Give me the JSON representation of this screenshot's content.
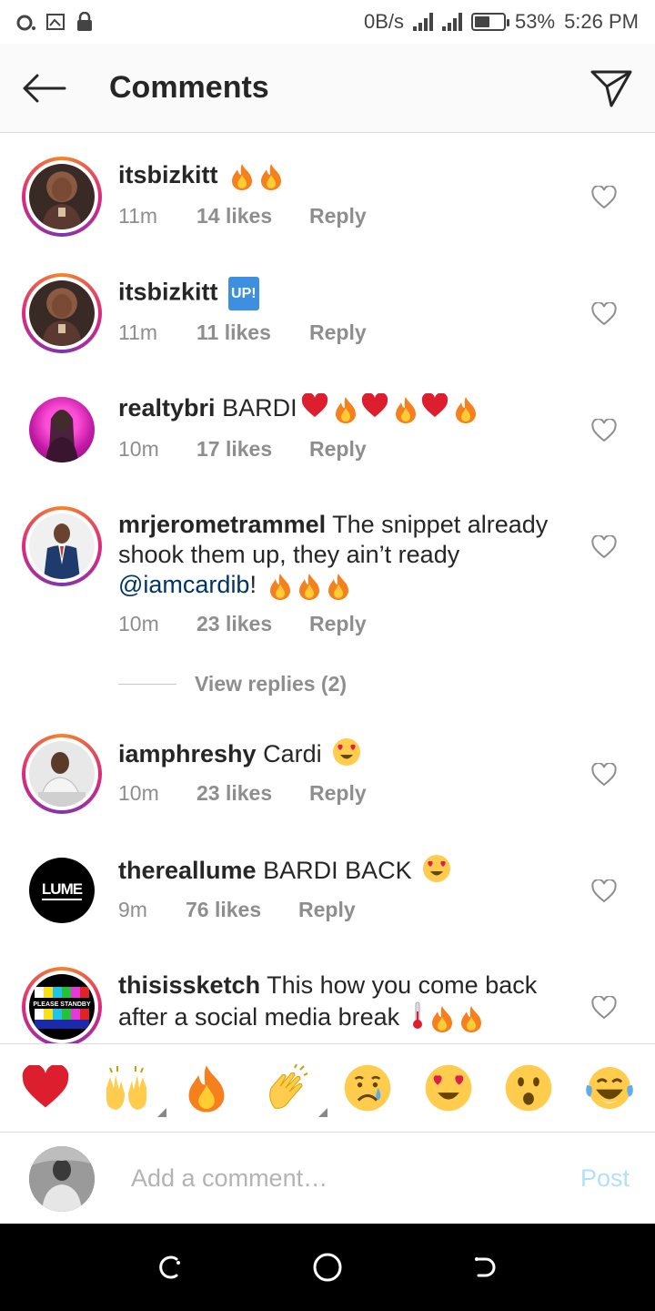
{
  "status_bar": {
    "speed": "0B/s",
    "battery": "53%",
    "battery_level": 0.53,
    "time": "5:26 PM"
  },
  "header": {
    "title": "Comments"
  },
  "comments": [
    {
      "username": "itsbizkitt",
      "text": "",
      "time": "11m",
      "likes": "14 likes",
      "reply": "Reply",
      "emoji": [
        "fire",
        "fire"
      ]
    },
    {
      "username": "itsbizkitt",
      "text": "",
      "badge": "UP!",
      "time": "11m",
      "likes": "11 likes",
      "reply": "Reply"
    },
    {
      "username": "realtybri",
      "text": "BARDI",
      "time": "10m",
      "likes": "17 likes",
      "reply": "Reply",
      "emoji": [
        "heart",
        "fire",
        "heart",
        "fire",
        "heart",
        "fire"
      ]
    },
    {
      "username": "mrjerometrammel",
      "text": "The snippet already shook them up, they ain’t ready",
      "mention": "@iamcardib",
      "after_mention": "!",
      "time": "10m",
      "likes": "23 likes",
      "reply": "Reply",
      "emoji": [
        "fire",
        "fire",
        "fire"
      ]
    },
    {
      "username": "iamphreshy",
      "text": "Cardi",
      "time": "10m",
      "likes": "23 likes",
      "reply": "Reply",
      "emoji": [
        "heart-eyes"
      ]
    },
    {
      "username": "thereallume",
      "text": "BARDI BACK",
      "time": "9m",
      "likes": "76 likes",
      "reply": "Reply",
      "emoji": [
        "heart-eyes"
      ],
      "avatar_logo": "LUME"
    },
    {
      "username": "thisissketch",
      "text": "This how you come back after a social media break",
      "emoji": [
        "thermometer",
        "fire",
        "fire"
      ],
      "avatar_logo": "PLEASE STANDBY"
    }
  ],
  "view_replies": "View replies (2)",
  "emoji_bar": [
    "red-heart",
    "raising-hands",
    "fire",
    "clapping-hands",
    "crying-face",
    "heart-eyes",
    "astonished-face",
    "tears-of-joy"
  ],
  "input": {
    "placeholder": "Add a comment…",
    "post_label": "Post"
  },
  "colors": {
    "post_disabled": "#b2dffc",
    "mention": "#003569",
    "meta": "#8e8e8e"
  }
}
